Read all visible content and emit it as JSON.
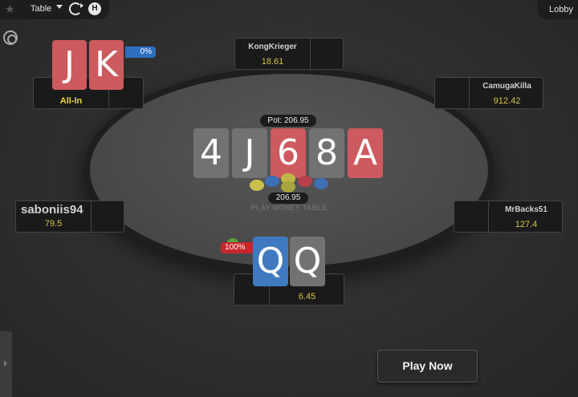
{
  "topbar": {
    "table_label": "Table",
    "lobby_label": "Lobby"
  },
  "table": {
    "label": "PLAY MONEY TABLE",
    "pot_label": "Pot: 206.95",
    "pot_amount": "206.95"
  },
  "board": [
    {
      "rank": "4",
      "color": "grey"
    },
    {
      "rank": "J",
      "color": "grey"
    },
    {
      "rank": "6",
      "color": "red"
    },
    {
      "rank": "8",
      "color": "grey"
    },
    {
      "rank": "A",
      "color": "red"
    }
  ],
  "seats": {
    "top_left": {
      "status": "All-In",
      "cards": [
        "J",
        "K"
      ],
      "equity": "0%"
    },
    "top": {
      "name": "KongKrieger",
      "stack": "18.61"
    },
    "top_right": {
      "name": "CamugaKilla",
      "stack": "912.42"
    },
    "left": {
      "name": "saboniis94",
      "stack": "79.5"
    },
    "right": {
      "name": "MrBacks51",
      "stack": "127.4"
    },
    "hero": {
      "stack": "6.45",
      "cards": [
        "Q",
        "Q"
      ],
      "equity": "100%"
    }
  },
  "buttons": {
    "play_now": "Play Now"
  },
  "colors": {
    "stack_yellow": "#d6c34a",
    "card_red": "#cd5a5e",
    "card_blue": "#3f7ac0",
    "card_grey": "#727272",
    "equity_blue": "#2f6fc0",
    "equity_red": "#c9262b"
  },
  "icons": {
    "star": "star-icon",
    "refresh": "refresh-icon",
    "help": "h-icon",
    "target": "target-icon"
  }
}
